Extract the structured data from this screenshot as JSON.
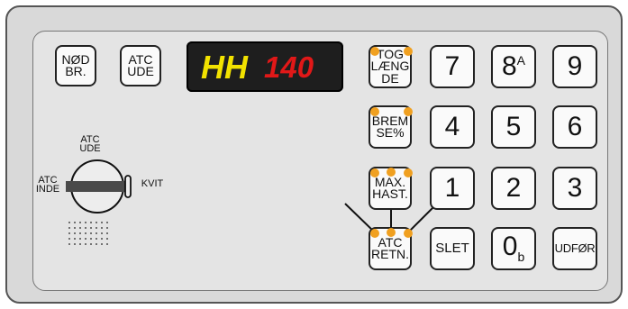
{
  "panel": {
    "left_buttons": {
      "nod_br": [
        "NØD",
        "BR."
      ],
      "atc_ude": [
        "ATC",
        "UDE"
      ]
    },
    "display": {
      "mode": "HH",
      "value": "140",
      "mode_color": "#f2e200",
      "value_color": "#e11818"
    },
    "function_keys": {
      "toglaengde": [
        "TOG",
        "LÆNG",
        "DE"
      ],
      "bremse": [
        "BREM",
        "SE%"
      ],
      "max_hast": [
        "MAX.",
        "HAST."
      ],
      "atc_retn": [
        "ATC",
        "RETN."
      ]
    },
    "keypad": {
      "k7": "7",
      "k8": "8",
      "k8_sup": "A",
      "k9": "9",
      "k4": "4",
      "k5": "5",
      "k6": "6",
      "k1": "1",
      "k2": "2",
      "k3": "3",
      "slet": "SLET",
      "k0": "0",
      "k0_sub": "b",
      "udfor": "UDFØR"
    },
    "switch": {
      "top_label": [
        "ATC",
        "UDE"
      ],
      "left_label": [
        "ATC",
        "INDE"
      ],
      "right_label": "KVIT"
    },
    "indicator_color": "#f0a020"
  }
}
